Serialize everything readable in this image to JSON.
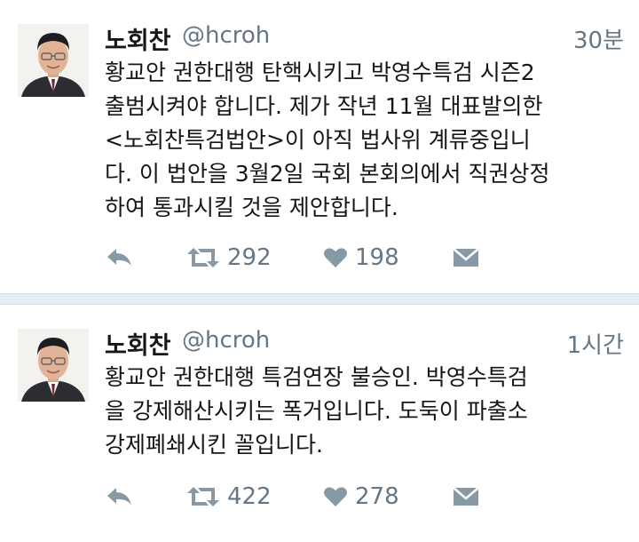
{
  "tweets": [
    {
      "name": "노회찬",
      "handle": "@hcroh",
      "time": "30분",
      "lines": [
        "황교안 권한대행 탄핵시키고 박영수특검 시즌2",
        "출범시켜야 합니다. 제가 작년 11월 대표발의한",
        "<노회찬특검법안>이 아직 법사위 계류중입니",
        "다. 이 법안을 3월2일 국회 본회의에서 직권상정",
        "하여 통과시킬 것을 제안합니다."
      ],
      "retweets": "292",
      "likes": "198"
    },
    {
      "name": "노회찬",
      "handle": "@hcroh",
      "time": "1시간",
      "lines": [
        "황교안 권한대행 특검연장 불승인. 박영수특검",
        "을 강제해산시키는 폭거입니다. 도둑이 파출소",
        "강제폐쇄시킨 꼴입니다."
      ],
      "retweets": "422",
      "likes": "278"
    }
  ],
  "icons": {
    "reply": "reply-icon",
    "retweet": "retweet-icon",
    "like": "heart-icon",
    "message": "envelope-icon"
  },
  "colors": {
    "text": "#14171a",
    "secondary": "#657786",
    "icon": "#8899a6",
    "divider": "#e6ecf0"
  }
}
